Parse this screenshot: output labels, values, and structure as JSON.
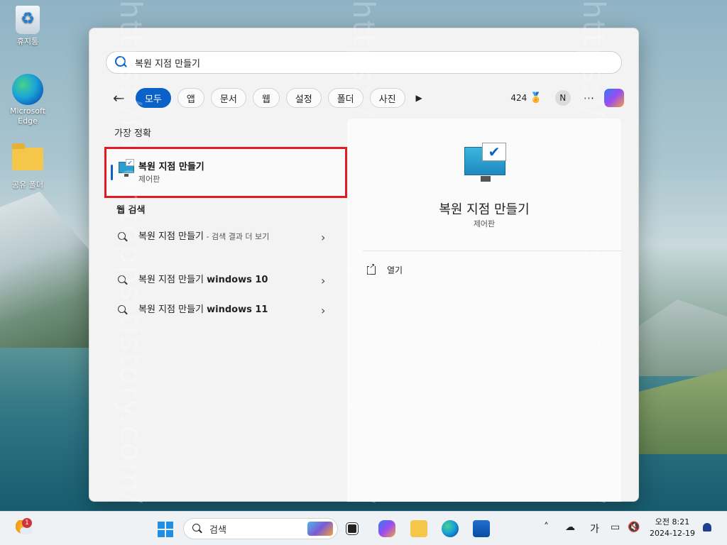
{
  "desktop": {
    "icons": [
      {
        "label": "휴지통"
      },
      {
        "label": "Microsoft Edge"
      },
      {
        "label": "공유 폴더"
      }
    ]
  },
  "search": {
    "query": "복원 지점 만들기",
    "filters": [
      "모두",
      "앱",
      "문서",
      "웹",
      "설정",
      "폴더",
      "사진"
    ],
    "active_filter": "모두",
    "points": "424",
    "avatar_initial": "N",
    "more": "···"
  },
  "results": {
    "best_match_header": "가장 정확",
    "best_match": {
      "title": "복원 지점 만들기",
      "subtitle": "제어판"
    },
    "web_header": "웹 검색",
    "web_items": [
      {
        "main": "복원 지점 만들기",
        "suffix": " - 검색 결과 더 보기"
      },
      {
        "main": "복원 지점 만들기 ",
        "bold": "windows 10"
      },
      {
        "main": "복원 지점 만들기 ",
        "bold": "windows 11"
      }
    ]
  },
  "preview": {
    "title": "복원 지점 만들기",
    "subtitle": "제어판",
    "actions": [
      {
        "label": "열기"
      }
    ]
  },
  "watermark": "https://favoritepps.tistory.com/",
  "taskbar": {
    "weather_badge": "1",
    "search_label": "검색",
    "ime": "가",
    "clock_time": "오전 8:21",
    "clock_date": "2024-12-19"
  },
  "colors": {
    "accent": "#0a62c9",
    "highlight_box": "#e21b23"
  }
}
